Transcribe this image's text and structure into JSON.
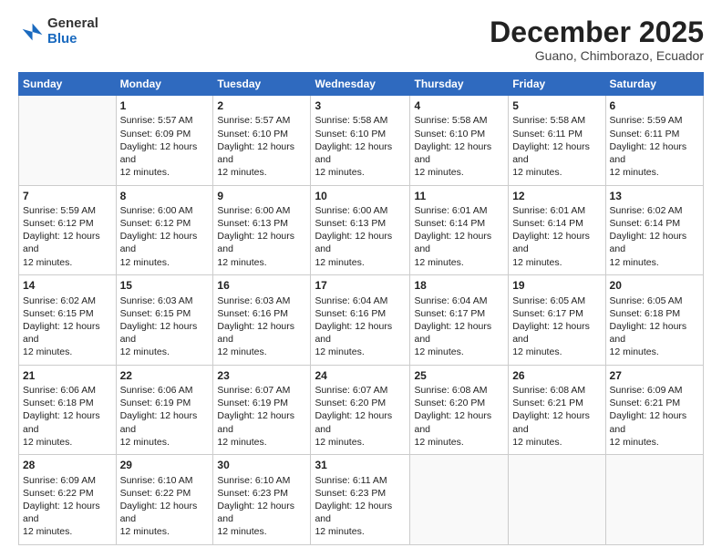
{
  "header": {
    "logo": {
      "general": "General",
      "blue": "Blue"
    },
    "title": "December 2025",
    "subtitle": "Guano, Chimborazo, Ecuador"
  },
  "days": [
    "Sunday",
    "Monday",
    "Tuesday",
    "Wednesday",
    "Thursday",
    "Friday",
    "Saturday"
  ],
  "weeks": [
    [
      {
        "day": "",
        "sunrise": "",
        "sunset": "",
        "daylight": ""
      },
      {
        "day": "1",
        "sunrise": "Sunrise: 5:57 AM",
        "sunset": "Sunset: 6:09 PM",
        "daylight": "Daylight: 12 hours and 12 minutes."
      },
      {
        "day": "2",
        "sunrise": "Sunrise: 5:57 AM",
        "sunset": "Sunset: 6:10 PM",
        "daylight": "Daylight: 12 hours and 12 minutes."
      },
      {
        "day": "3",
        "sunrise": "Sunrise: 5:58 AM",
        "sunset": "Sunset: 6:10 PM",
        "daylight": "Daylight: 12 hours and 12 minutes."
      },
      {
        "day": "4",
        "sunrise": "Sunrise: 5:58 AM",
        "sunset": "Sunset: 6:10 PM",
        "daylight": "Daylight: 12 hours and 12 minutes."
      },
      {
        "day": "5",
        "sunrise": "Sunrise: 5:58 AM",
        "sunset": "Sunset: 6:11 PM",
        "daylight": "Daylight: 12 hours and 12 minutes."
      },
      {
        "day": "6",
        "sunrise": "Sunrise: 5:59 AM",
        "sunset": "Sunset: 6:11 PM",
        "daylight": "Daylight: 12 hours and 12 minutes."
      }
    ],
    [
      {
        "day": "7",
        "sunrise": "Sunrise: 5:59 AM",
        "sunset": "Sunset: 6:12 PM",
        "daylight": "Daylight: 12 hours and 12 minutes."
      },
      {
        "day": "8",
        "sunrise": "Sunrise: 6:00 AM",
        "sunset": "Sunset: 6:12 PM",
        "daylight": "Daylight: 12 hours and 12 minutes."
      },
      {
        "day": "9",
        "sunrise": "Sunrise: 6:00 AM",
        "sunset": "Sunset: 6:13 PM",
        "daylight": "Daylight: 12 hours and 12 minutes."
      },
      {
        "day": "10",
        "sunrise": "Sunrise: 6:00 AM",
        "sunset": "Sunset: 6:13 PM",
        "daylight": "Daylight: 12 hours and 12 minutes."
      },
      {
        "day": "11",
        "sunrise": "Sunrise: 6:01 AM",
        "sunset": "Sunset: 6:14 PM",
        "daylight": "Daylight: 12 hours and 12 minutes."
      },
      {
        "day": "12",
        "sunrise": "Sunrise: 6:01 AM",
        "sunset": "Sunset: 6:14 PM",
        "daylight": "Daylight: 12 hours and 12 minutes."
      },
      {
        "day": "13",
        "sunrise": "Sunrise: 6:02 AM",
        "sunset": "Sunset: 6:14 PM",
        "daylight": "Daylight: 12 hours and 12 minutes."
      }
    ],
    [
      {
        "day": "14",
        "sunrise": "Sunrise: 6:02 AM",
        "sunset": "Sunset: 6:15 PM",
        "daylight": "Daylight: 12 hours and 12 minutes."
      },
      {
        "day": "15",
        "sunrise": "Sunrise: 6:03 AM",
        "sunset": "Sunset: 6:15 PM",
        "daylight": "Daylight: 12 hours and 12 minutes."
      },
      {
        "day": "16",
        "sunrise": "Sunrise: 6:03 AM",
        "sunset": "Sunset: 6:16 PM",
        "daylight": "Daylight: 12 hours and 12 minutes."
      },
      {
        "day": "17",
        "sunrise": "Sunrise: 6:04 AM",
        "sunset": "Sunset: 6:16 PM",
        "daylight": "Daylight: 12 hours and 12 minutes."
      },
      {
        "day": "18",
        "sunrise": "Sunrise: 6:04 AM",
        "sunset": "Sunset: 6:17 PM",
        "daylight": "Daylight: 12 hours and 12 minutes."
      },
      {
        "day": "19",
        "sunrise": "Sunrise: 6:05 AM",
        "sunset": "Sunset: 6:17 PM",
        "daylight": "Daylight: 12 hours and 12 minutes."
      },
      {
        "day": "20",
        "sunrise": "Sunrise: 6:05 AM",
        "sunset": "Sunset: 6:18 PM",
        "daylight": "Daylight: 12 hours and 12 minutes."
      }
    ],
    [
      {
        "day": "21",
        "sunrise": "Sunrise: 6:06 AM",
        "sunset": "Sunset: 6:18 PM",
        "daylight": "Daylight: 12 hours and 12 minutes."
      },
      {
        "day": "22",
        "sunrise": "Sunrise: 6:06 AM",
        "sunset": "Sunset: 6:19 PM",
        "daylight": "Daylight: 12 hours and 12 minutes."
      },
      {
        "day": "23",
        "sunrise": "Sunrise: 6:07 AM",
        "sunset": "Sunset: 6:19 PM",
        "daylight": "Daylight: 12 hours and 12 minutes."
      },
      {
        "day": "24",
        "sunrise": "Sunrise: 6:07 AM",
        "sunset": "Sunset: 6:20 PM",
        "daylight": "Daylight: 12 hours and 12 minutes."
      },
      {
        "day": "25",
        "sunrise": "Sunrise: 6:08 AM",
        "sunset": "Sunset: 6:20 PM",
        "daylight": "Daylight: 12 hours and 12 minutes."
      },
      {
        "day": "26",
        "sunrise": "Sunrise: 6:08 AM",
        "sunset": "Sunset: 6:21 PM",
        "daylight": "Daylight: 12 hours and 12 minutes."
      },
      {
        "day": "27",
        "sunrise": "Sunrise: 6:09 AM",
        "sunset": "Sunset: 6:21 PM",
        "daylight": "Daylight: 12 hours and 12 minutes."
      }
    ],
    [
      {
        "day": "28",
        "sunrise": "Sunrise: 6:09 AM",
        "sunset": "Sunset: 6:22 PM",
        "daylight": "Daylight: 12 hours and 12 minutes."
      },
      {
        "day": "29",
        "sunrise": "Sunrise: 6:10 AM",
        "sunset": "Sunset: 6:22 PM",
        "daylight": "Daylight: 12 hours and 12 minutes."
      },
      {
        "day": "30",
        "sunrise": "Sunrise: 6:10 AM",
        "sunset": "Sunset: 6:23 PM",
        "daylight": "Daylight: 12 hours and 12 minutes."
      },
      {
        "day": "31",
        "sunrise": "Sunrise: 6:11 AM",
        "sunset": "Sunset: 6:23 PM",
        "daylight": "Daylight: 12 hours and 12 minutes."
      },
      {
        "day": "",
        "sunrise": "",
        "sunset": "",
        "daylight": ""
      },
      {
        "day": "",
        "sunrise": "",
        "sunset": "",
        "daylight": ""
      },
      {
        "day": "",
        "sunrise": "",
        "sunset": "",
        "daylight": ""
      }
    ]
  ]
}
